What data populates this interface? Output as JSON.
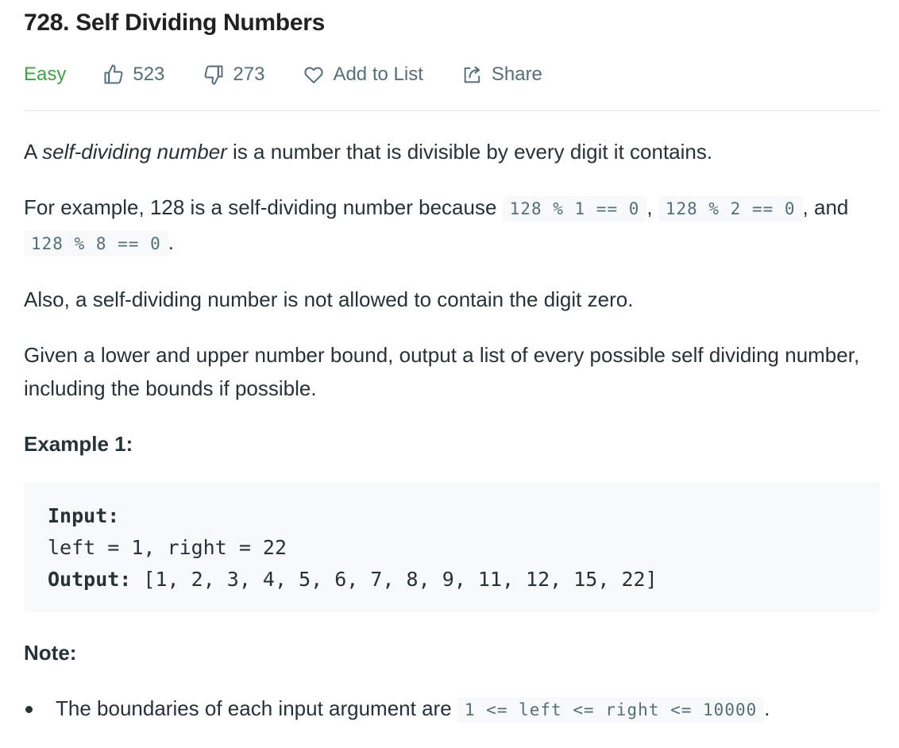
{
  "problem": {
    "title": "728. Self Dividing Numbers",
    "difficulty": "Easy",
    "likes": "523",
    "dislikes": "273",
    "add_to_list": "Add to List",
    "share": "Share"
  },
  "description": {
    "p1_prefix": "A ",
    "p1_em": "self-dividing number",
    "p1_suffix": " is a number that is divisible by every digit it contains.",
    "p2_prefix": "For example, 128 is a self-dividing number because ",
    "p2_code1": "128 % 1 == 0",
    "p2_sep1": ", ",
    "p2_code2": "128 % 2 == 0",
    "p2_sep2": ", and ",
    "p2_code3": "128 % 8 == 0",
    "p2_end": ".",
    "p3": "Also, a self-dividing number is not allowed to contain the digit zero.",
    "p4": "Given a lower and upper number bound, output a list of every possible self dividing number, including the bounds if possible."
  },
  "example": {
    "heading": "Example 1:",
    "input_label": "Input:",
    "input_value": "left = 1, right = 22",
    "output_label": "Output:",
    "output_value": " [1, 2, 3, 4, 5, 6, 7, 8, 9, 11, 12, 15, 22]"
  },
  "note": {
    "heading": "Note:",
    "item_prefix": "The boundaries of each input argument are ",
    "item_code": "1 <= left <= right <= 10000",
    "item_end": "."
  },
  "colors": {
    "easy": "#43a047",
    "meta_text": "#546e7a",
    "text": "#263238",
    "code_bg": "#f7f9fa"
  }
}
